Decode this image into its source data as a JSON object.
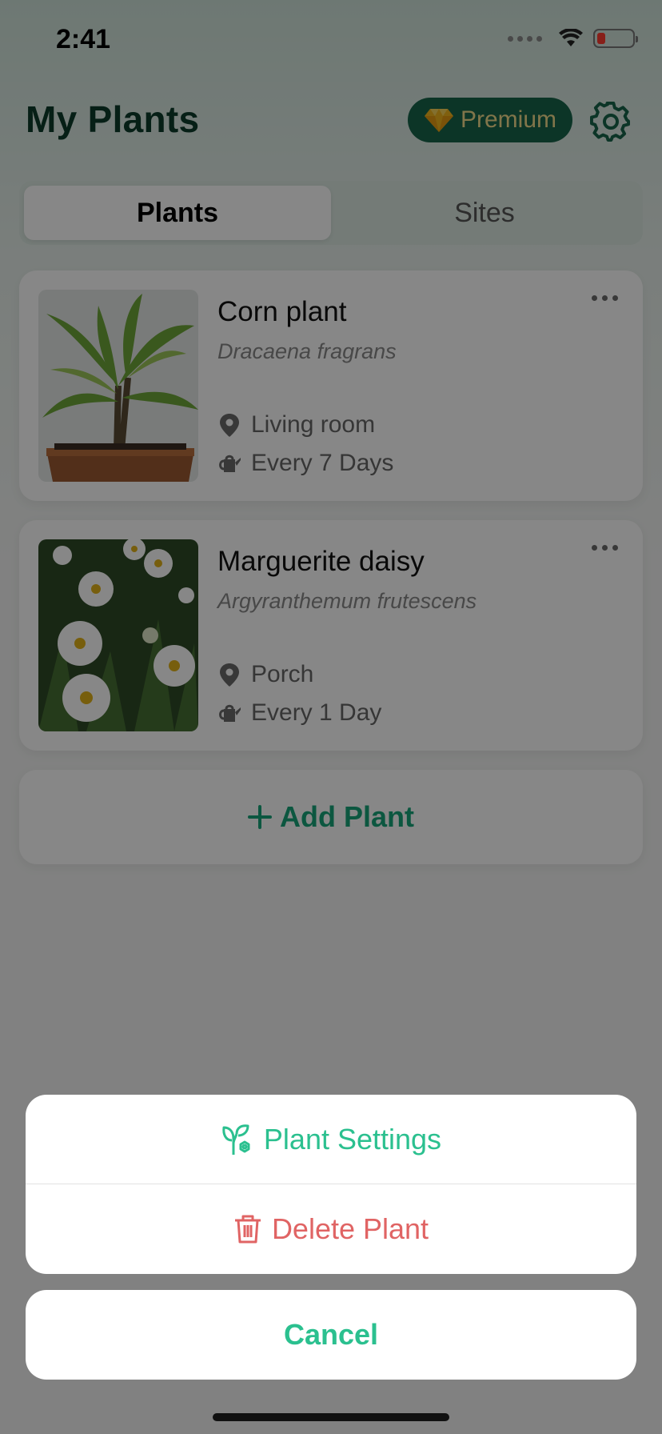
{
  "status_bar": {
    "time": "2:41"
  },
  "header": {
    "title": "My Plants",
    "premium_label": "Premium"
  },
  "tabs": [
    {
      "label": "Plants",
      "active": true
    },
    {
      "label": "Sites",
      "active": false
    }
  ],
  "plants": [
    {
      "name": "Corn plant",
      "scientific_name": "Dracaena fragrans",
      "location": "Living room",
      "watering": "Every 7 Days"
    },
    {
      "name": "Marguerite daisy",
      "scientific_name": "Argyranthemum frutescens",
      "location": "Porch",
      "watering": "Every 1 Day"
    }
  ],
  "add_plant_label": "Add Plant",
  "action_sheet": {
    "settings_label": "Plant Settings",
    "delete_label": "Delete Plant",
    "cancel_label": "Cancel"
  },
  "colors": {
    "brand_green": "#17644a",
    "accent_green": "#2bc08f",
    "delete_red": "#e06464",
    "premium_gold": "#f4dd8c"
  },
  "icons": [
    "wifi-icon",
    "battery-icon",
    "diamond-icon",
    "gear-icon",
    "location-pin-icon",
    "watering-can-icon",
    "more-icon",
    "plus-icon",
    "plant-settings-icon",
    "trash-icon"
  ]
}
